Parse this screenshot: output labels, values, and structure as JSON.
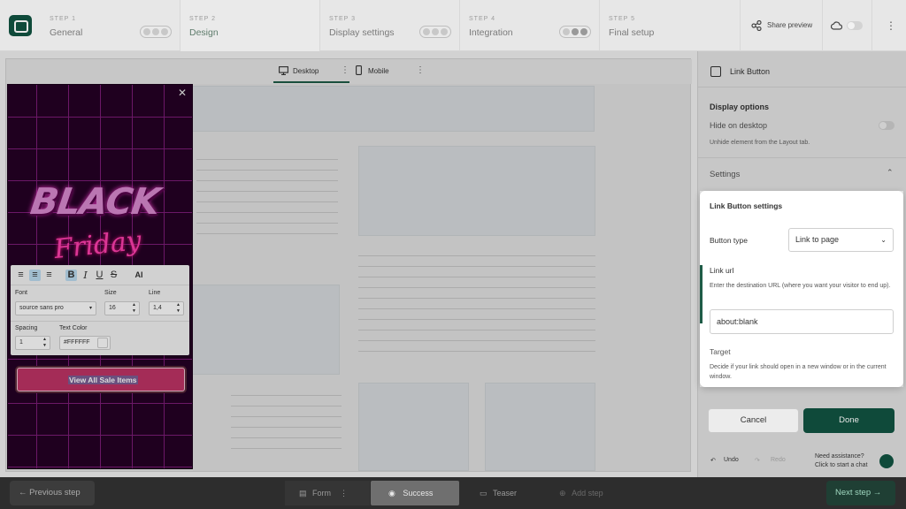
{
  "steps": [
    {
      "num": "STEP 1",
      "name": "General"
    },
    {
      "num": "STEP 2",
      "name": "Design"
    },
    {
      "num": "STEP 3",
      "name": "Display settings"
    },
    {
      "num": "STEP 4",
      "name": "Integration"
    },
    {
      "num": "STEP 5",
      "name": "Final setup"
    }
  ],
  "topbar": {
    "share_label": "Share preview"
  },
  "device_tabs": {
    "desktop": "Desktop",
    "mobile": "Mobile"
  },
  "popup": {
    "headline_1": "BLACK",
    "headline_2": "Friday",
    "cta_label": "View All Sale Items"
  },
  "editor": {
    "ai_label": "AI",
    "font_label": "Font",
    "font_value": "source sans pro",
    "size_label": "Size",
    "size_value": "16",
    "line_label": "Line",
    "line_value": "1,4",
    "spacing_label": "Spacing",
    "spacing_value": "1",
    "text_color_label": "Text Color",
    "text_color_value": "#FFFFFF"
  },
  "panel": {
    "title": "Link Button",
    "display_options": "Display options",
    "hide_desktop": "Hide on desktop",
    "unhide_hint": "Unhide element from the Layout tab.",
    "settings": "Settings",
    "card_title": "Link Button settings",
    "button_type_label": "Button type",
    "button_type_value": "Link to page",
    "link_url_label": "Link url",
    "link_url_hint": "Enter the destination URL (where you want your visitor to end up).",
    "link_url_value": "about:blank",
    "target_label": "Target",
    "target_hint": "Decide if your link should open in a new window or in the current window.",
    "cancel": "Cancel",
    "done": "Done",
    "undo": "Undo",
    "redo": "Redo",
    "assist_title": "Need assistance?",
    "assist_sub": "Click to start a chat"
  },
  "bottombar": {
    "prev": "Previous step",
    "form": "Form",
    "success": "Success",
    "teaser": "Teaser",
    "add_step": "Add step",
    "next": "Next step"
  },
  "colors": {
    "brand": "#0f4a3a",
    "cta": "#bf3466",
    "popup_bg": "#250025"
  }
}
